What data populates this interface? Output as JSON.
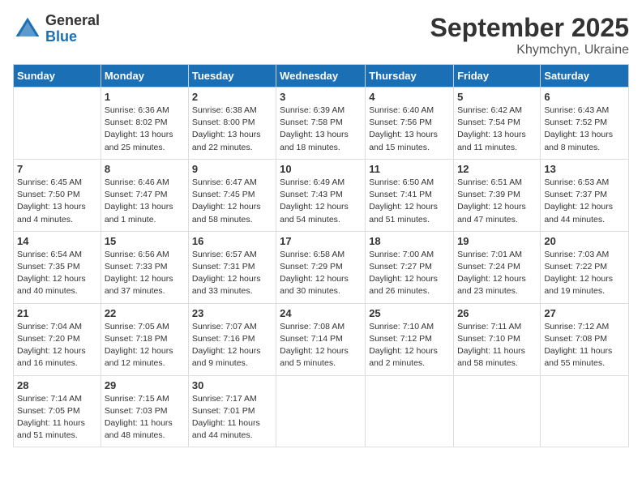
{
  "logo": {
    "general": "General",
    "blue": "Blue"
  },
  "title": "September 2025",
  "subtitle": "Khymchyn, Ukraine",
  "days_of_week": [
    "Sunday",
    "Monday",
    "Tuesday",
    "Wednesday",
    "Thursday",
    "Friday",
    "Saturday"
  ],
  "weeks": [
    [
      {
        "day": "",
        "info": ""
      },
      {
        "day": "1",
        "info": "Sunrise: 6:36 AM\nSunset: 8:02 PM\nDaylight: 13 hours\nand 25 minutes."
      },
      {
        "day": "2",
        "info": "Sunrise: 6:38 AM\nSunset: 8:00 PM\nDaylight: 13 hours\nand 22 minutes."
      },
      {
        "day": "3",
        "info": "Sunrise: 6:39 AM\nSunset: 7:58 PM\nDaylight: 13 hours\nand 18 minutes."
      },
      {
        "day": "4",
        "info": "Sunrise: 6:40 AM\nSunset: 7:56 PM\nDaylight: 13 hours\nand 15 minutes."
      },
      {
        "day": "5",
        "info": "Sunrise: 6:42 AM\nSunset: 7:54 PM\nDaylight: 13 hours\nand 11 minutes."
      },
      {
        "day": "6",
        "info": "Sunrise: 6:43 AM\nSunset: 7:52 PM\nDaylight: 13 hours\nand 8 minutes."
      }
    ],
    [
      {
        "day": "7",
        "info": "Sunrise: 6:45 AM\nSunset: 7:50 PM\nDaylight: 13 hours\nand 4 minutes."
      },
      {
        "day": "8",
        "info": "Sunrise: 6:46 AM\nSunset: 7:47 PM\nDaylight: 13 hours\nand 1 minute."
      },
      {
        "day": "9",
        "info": "Sunrise: 6:47 AM\nSunset: 7:45 PM\nDaylight: 12 hours\nand 58 minutes."
      },
      {
        "day": "10",
        "info": "Sunrise: 6:49 AM\nSunset: 7:43 PM\nDaylight: 12 hours\nand 54 minutes."
      },
      {
        "day": "11",
        "info": "Sunrise: 6:50 AM\nSunset: 7:41 PM\nDaylight: 12 hours\nand 51 minutes."
      },
      {
        "day": "12",
        "info": "Sunrise: 6:51 AM\nSunset: 7:39 PM\nDaylight: 12 hours\nand 47 minutes."
      },
      {
        "day": "13",
        "info": "Sunrise: 6:53 AM\nSunset: 7:37 PM\nDaylight: 12 hours\nand 44 minutes."
      }
    ],
    [
      {
        "day": "14",
        "info": "Sunrise: 6:54 AM\nSunset: 7:35 PM\nDaylight: 12 hours\nand 40 minutes."
      },
      {
        "day": "15",
        "info": "Sunrise: 6:56 AM\nSunset: 7:33 PM\nDaylight: 12 hours\nand 37 minutes."
      },
      {
        "day": "16",
        "info": "Sunrise: 6:57 AM\nSunset: 7:31 PM\nDaylight: 12 hours\nand 33 minutes."
      },
      {
        "day": "17",
        "info": "Sunrise: 6:58 AM\nSunset: 7:29 PM\nDaylight: 12 hours\nand 30 minutes."
      },
      {
        "day": "18",
        "info": "Sunrise: 7:00 AM\nSunset: 7:27 PM\nDaylight: 12 hours\nand 26 minutes."
      },
      {
        "day": "19",
        "info": "Sunrise: 7:01 AM\nSunset: 7:24 PM\nDaylight: 12 hours\nand 23 minutes."
      },
      {
        "day": "20",
        "info": "Sunrise: 7:03 AM\nSunset: 7:22 PM\nDaylight: 12 hours\nand 19 minutes."
      }
    ],
    [
      {
        "day": "21",
        "info": "Sunrise: 7:04 AM\nSunset: 7:20 PM\nDaylight: 12 hours\nand 16 minutes."
      },
      {
        "day": "22",
        "info": "Sunrise: 7:05 AM\nSunset: 7:18 PM\nDaylight: 12 hours\nand 12 minutes."
      },
      {
        "day": "23",
        "info": "Sunrise: 7:07 AM\nSunset: 7:16 PM\nDaylight: 12 hours\nand 9 minutes."
      },
      {
        "day": "24",
        "info": "Sunrise: 7:08 AM\nSunset: 7:14 PM\nDaylight: 12 hours\nand 5 minutes."
      },
      {
        "day": "25",
        "info": "Sunrise: 7:10 AM\nSunset: 7:12 PM\nDaylight: 12 hours\nand 2 minutes."
      },
      {
        "day": "26",
        "info": "Sunrise: 7:11 AM\nSunset: 7:10 PM\nDaylight: 11 hours\nand 58 minutes."
      },
      {
        "day": "27",
        "info": "Sunrise: 7:12 AM\nSunset: 7:08 PM\nDaylight: 11 hours\nand 55 minutes."
      }
    ],
    [
      {
        "day": "28",
        "info": "Sunrise: 7:14 AM\nSunset: 7:05 PM\nDaylight: 11 hours\nand 51 minutes."
      },
      {
        "day": "29",
        "info": "Sunrise: 7:15 AM\nSunset: 7:03 PM\nDaylight: 11 hours\nand 48 minutes."
      },
      {
        "day": "30",
        "info": "Sunrise: 7:17 AM\nSunset: 7:01 PM\nDaylight: 11 hours\nand 44 minutes."
      },
      {
        "day": "",
        "info": ""
      },
      {
        "day": "",
        "info": ""
      },
      {
        "day": "",
        "info": ""
      },
      {
        "day": "",
        "info": ""
      }
    ]
  ]
}
